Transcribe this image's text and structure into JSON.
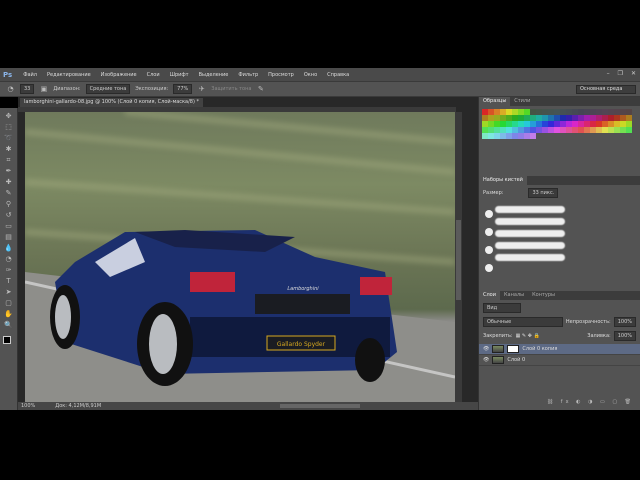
{
  "app": {
    "logo": "Ps"
  },
  "menu": [
    "Файл",
    "Редактирование",
    "Изображение",
    "Слои",
    "Шрифт",
    "Выделение",
    "Фильтр",
    "Просмотр",
    "Окно",
    "Справка"
  ],
  "window_controls": [
    "–",
    "❐",
    "✕"
  ],
  "options": {
    "range_label": "Диапазон:",
    "range_value": "Средние тона",
    "exposure_label": "Экспозиция:",
    "exposure_value": "77%",
    "protect_label": "Защитить тона",
    "workspace": "Основная среда"
  },
  "document": {
    "tab": "lamborghini-gallardo-08.jpg @ 100% (Слой 0 копия, Слой-маска/8) *",
    "plate": "Gallardo Spyder",
    "badge": "Lamborghini"
  },
  "status": {
    "zoom": "100%",
    "doc": "Док: 4,12M/8,91M"
  },
  "swatches_panel": {
    "tabs": [
      "Образцы",
      "Стили"
    ]
  },
  "brush_panel": {
    "title": "Наборы кистей",
    "size_label": "Размер:",
    "size_value": "33 пикс."
  },
  "layers_panel": {
    "tabs": [
      "Слои",
      "Каналы",
      "Контуры"
    ],
    "filter": "Вид",
    "blend_mode": "Обычные",
    "opacity_label": "Непрозрачность:",
    "opacity_value": "100%",
    "lock_label": "Закрепить:",
    "fill_label": "Заливка:",
    "fill_value": "100%",
    "layers": [
      {
        "name": "Слой 0 копия",
        "selected": true
      },
      {
        "name": "Слой 0",
        "selected": false
      }
    ]
  }
}
